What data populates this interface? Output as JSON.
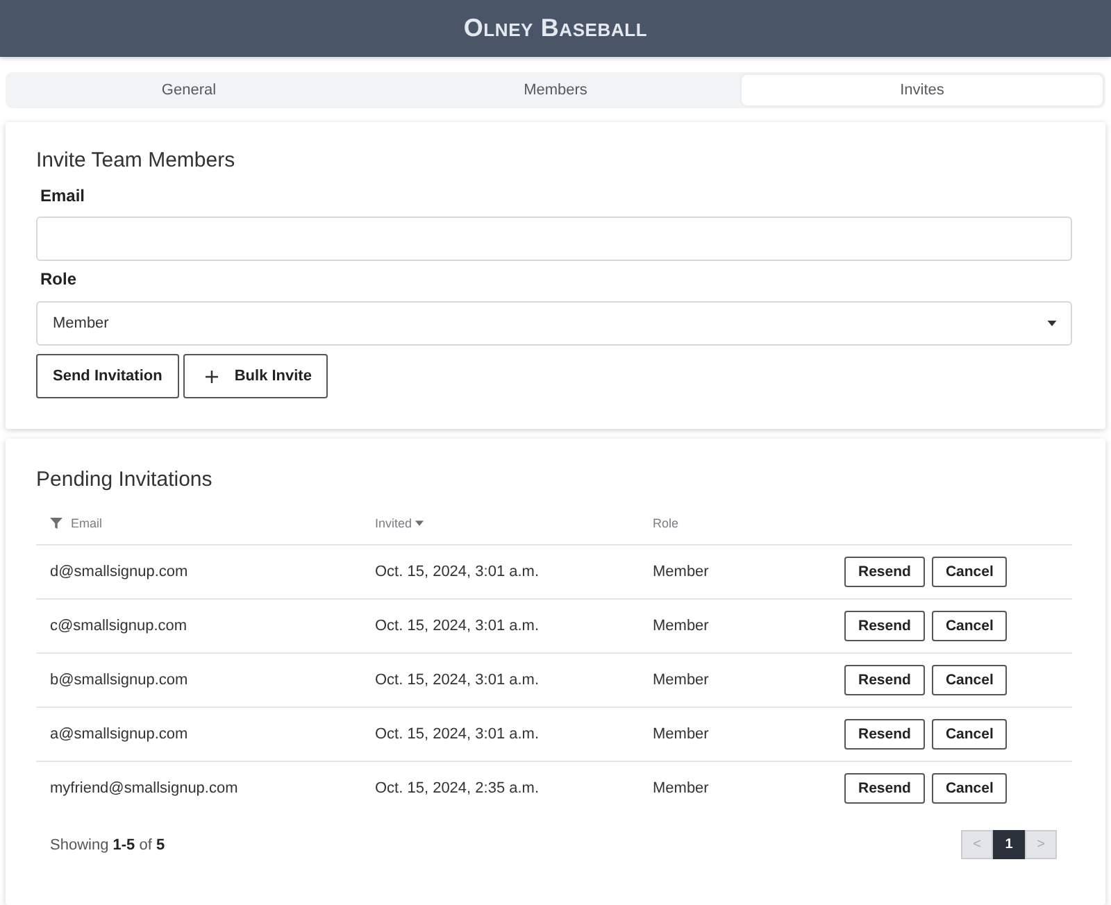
{
  "header": {
    "title": "Olney Baseball"
  },
  "tabs": [
    {
      "label": "General",
      "selected": false
    },
    {
      "label": "Members",
      "selected": false
    },
    {
      "label": "Invites",
      "selected": true
    }
  ],
  "invite_form": {
    "title": "Invite Team Members",
    "email": {
      "label": "Email"
    },
    "role": {
      "label": "Role",
      "value": "Member"
    },
    "buttons": [
      {
        "label": "Send Invitation",
        "kind": "plain"
      },
      {
        "label": "Bulk Invite",
        "kind": "add"
      }
    ]
  },
  "pending_invitations": {
    "title": "Pending Invitations",
    "columns": [
      {
        "label": "Email",
        "kind": "filter"
      },
      {
        "label": "Invited",
        "kind": "sorted"
      },
      {
        "label": "Role",
        "kind": "plain"
      }
    ],
    "rows": [
      {
        "email": "d@smallsignup.com",
        "invited": "Oct. 15, 2024, 3:01 a.m.",
        "role": "Member",
        "actions": [
          "Resend",
          "Cancel"
        ]
      },
      {
        "email": "c@smallsignup.com",
        "invited": "Oct. 15, 2024, 3:01 a.m.",
        "role": "Member",
        "actions": [
          "Resend",
          "Cancel"
        ]
      },
      {
        "email": "b@smallsignup.com",
        "invited": "Oct. 15, 2024, 3:01 a.m.",
        "role": "Member",
        "actions": [
          "Resend",
          "Cancel"
        ]
      },
      {
        "email": "a@smallsignup.com",
        "invited": "Oct. 15, 2024, 3:01 a.m.",
        "role": "Member",
        "actions": [
          "Resend",
          "Cancel"
        ]
      },
      {
        "email": "myfriend@smallsignup.com",
        "invited": "Oct. 15, 2024, 2:35 a.m.",
        "role": "Member",
        "actions": [
          "Resend",
          "Cancel"
        ]
      }
    ],
    "footer": "Showing **1-5** of **5**",
    "pagination": {
      "previous": {
        "label": "<",
        "disabled": true
      },
      "pages": [
        {
          "label": "1",
          "selected": true
        }
      ],
      "next": {
        "label": ">",
        "disabled": true
      }
    }
  }
}
